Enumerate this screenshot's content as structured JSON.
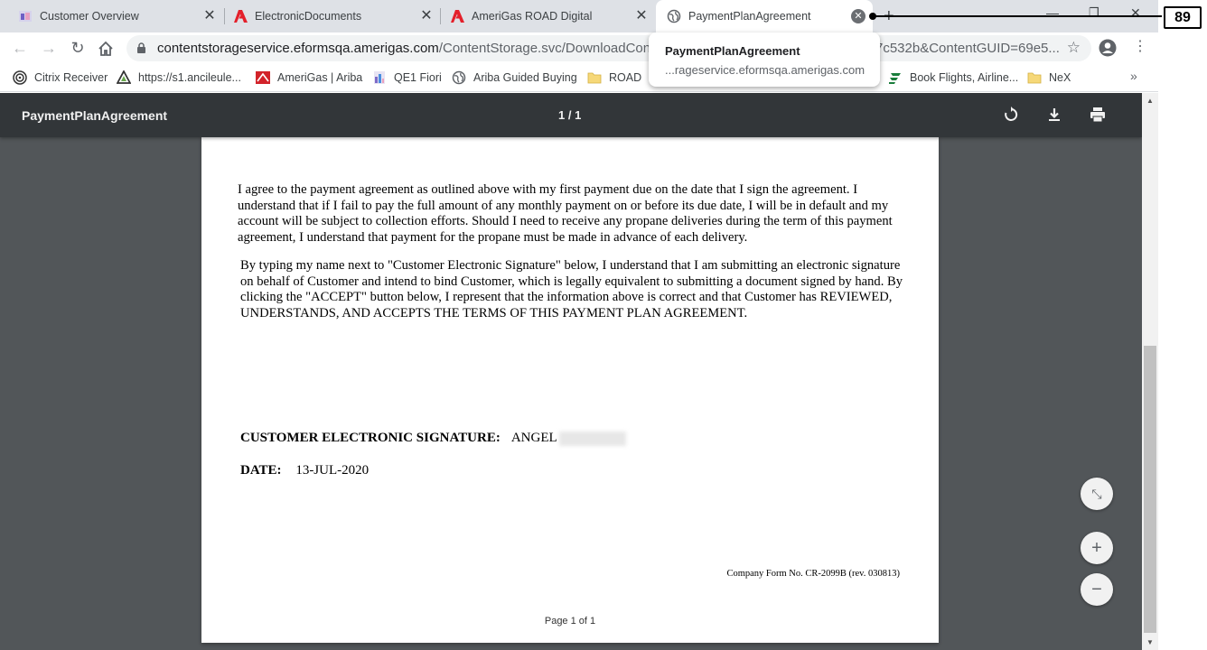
{
  "tabs": [
    {
      "title": "Customer Overview",
      "icon": "crm-icon"
    },
    {
      "title": "ElectronicDocuments",
      "icon": "adobe-icon"
    },
    {
      "title": "AmeriGas ROAD Digital",
      "icon": "adobe-icon"
    },
    {
      "title": "PaymentPlanAgreement",
      "icon": "globe-icon",
      "active": true
    }
  ],
  "address_bar": {
    "host": "contentstorageservice.eformsqa.amerigas.com",
    "path": "/ContentStorage.svc/DownloadContent?A",
    "tail": "7c532b&ContentGUID=69e5..."
  },
  "hover_card": {
    "title": "PaymentPlanAgreement",
    "url": "...rageservice.eformsqa.amerigas.com"
  },
  "bookmarks": [
    {
      "label": "Citrix Receiver",
      "icon": "citrix-icon"
    },
    {
      "label": "https://s1.ancileule...",
      "icon": "ancile-icon"
    },
    {
      "label": "AmeriGas | Ariba",
      "icon": "amerigas-icon"
    },
    {
      "label": "QE1 Fiori",
      "icon": "fiori-icon"
    },
    {
      "label": "Ariba Guided Buying",
      "icon": "globe-icon"
    },
    {
      "label": "ROAD",
      "icon": "folder-icon"
    },
    {
      "label": "Book Flights, Airline...",
      "icon": "flight-icon"
    },
    {
      "label": "NeX",
      "icon": "folder-icon"
    }
  ],
  "pdf": {
    "title": "PaymentPlanAgreement",
    "page_indicator": "1 / 1",
    "paragraph_1": "I agree to the payment agreement as outlined above with my first payment due on the date that I sign the agreement. I understand that if I fail to pay the full amount of any monthly payment on or before its due date, I will be in default and my account will be subject to collection efforts. Should I need to receive any propane deliveries during the term of this payment agreement, I understand that payment for the propane must be made in advance of each delivery.",
    "paragraph_2": "By typing my name next to \"Customer Electronic Signature\" below, I understand that I am submitting an electronic signature on behalf of Customer and intend to bind Customer, which is legally equivalent to submitting a document signed by hand. By clicking the \"ACCEPT\" button below, I represent that the information above is correct and that Customer has REVIEWED, UNDERSTANDS, AND ACCEPTS THE TERMS OF THIS PAYMENT PLAN AGREEMENT.",
    "signature_label": "CUSTOMER ELECTRONIC SIGNATURE:",
    "signature_value": "ANGEL",
    "date_label": "DATE:",
    "date_value": "13-JUL-2020",
    "form_number": "Company Form No. CR-2099B (rev. 030813)",
    "page_footer": "Page 1 of 1"
  },
  "annotation": {
    "number": "89"
  }
}
